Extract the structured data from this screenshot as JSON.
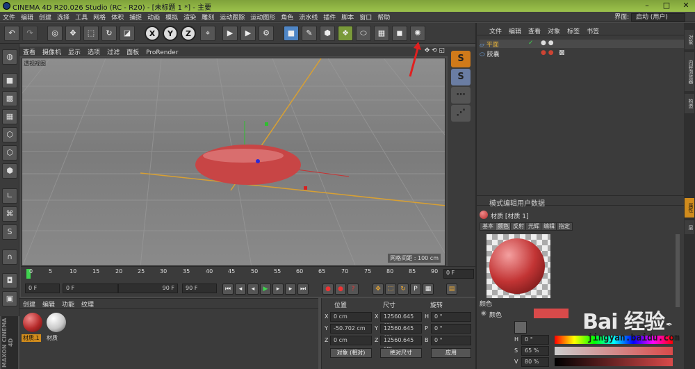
{
  "window": {
    "title": "CINEMA 4D R20.026 Studio (RC - R20) - [未标题 1 *] - 主要",
    "controls": [
      "–",
      "□",
      "✕"
    ]
  },
  "menu": [
    "文件",
    "编辑",
    "创建",
    "选择",
    "工具",
    "网格",
    "体积",
    "捕捉",
    "动画",
    "模拟",
    "渲染",
    "雕刻",
    "运动跟踪",
    "运动图形",
    "角色",
    "流水线",
    "插件",
    "脚本",
    "窗口",
    "帮助"
  ],
  "interface": {
    "label": "界面:",
    "value": "启动 (用户)"
  },
  "viewport": {
    "menu": [
      "查看",
      "摄像机",
      "显示",
      "选项",
      "过滤",
      "面板",
      "ProRender"
    ],
    "label": "透视视图",
    "status": "网格间距 : 100 cm"
  },
  "timeline": {
    "ticks": [
      "0",
      "5",
      "10",
      "15",
      "20",
      "25",
      "30",
      "35",
      "40",
      "45",
      "50",
      "55",
      "60",
      "65",
      "70",
      "75",
      "80",
      "85",
      "90"
    ],
    "current_frame": "0 F"
  },
  "transport": {
    "start": "0 F",
    "range_start": "0 F",
    "range_end": "90 F",
    "end": "90 F"
  },
  "material_manager": {
    "menu": [
      "创建",
      "编辑",
      "功能",
      "纹理"
    ],
    "materials": [
      {
        "name": "材质.1",
        "color": "#b52a2a"
      },
      {
        "name": "材质",
        "color": "#d8d8d8"
      }
    ],
    "brand_text": "MAXON CINEMA 4D"
  },
  "coordinates": {
    "headers": [
      "位置",
      "尺寸",
      "旋转"
    ],
    "rows": [
      {
        "axis": "X",
        "pos": "0 cm",
        "size_axis": "X",
        "size": "12560.645 cm",
        "rot_axis": "H",
        "rot": "0 °"
      },
      {
        "axis": "Y",
        "pos": "-50.702 cm",
        "size_axis": "Y",
        "size": "12560.645 cm",
        "rot_axis": "P",
        "rot": "0 °"
      },
      {
        "axis": "Z",
        "pos": "0 cm",
        "size_axis": "Z",
        "size": "12560.645 cm",
        "rot_axis": "B",
        "rot": "0 °"
      }
    ],
    "mode_object": "对象 (相对)",
    "mode_size": "绝对尺寸",
    "apply": "应用"
  },
  "object_manager": {
    "menu": [
      "文件",
      "编辑",
      "查看",
      "对象",
      "标签",
      "书签"
    ],
    "objects": [
      {
        "name": "平面",
        "selected": true
      },
      {
        "name": "胶囊",
        "selected": false
      }
    ]
  },
  "attribute_manager": {
    "menu": [
      "模式",
      "编辑",
      "用户数据"
    ],
    "title": "材质 [材质 1]",
    "tabs": [
      "基本",
      "颜色",
      "反射",
      "光辉",
      "编辑",
      "指定"
    ],
    "active_tab": "颜色",
    "section": "颜色",
    "color_label": "颜色",
    "swatch_color": "#d94a4a",
    "hsv": [
      {
        "label": "H",
        "value": "0 °"
      },
      {
        "label": "S",
        "value": "65 %"
      },
      {
        "label": "V",
        "value": "80 %"
      }
    ]
  },
  "side_tabs": [
    "对象",
    "内容浏览器",
    "构造",
    "属性",
    "层"
  ],
  "watermark": {
    "brand": "Bai  经验",
    "url": "jingyan.baidu.com"
  }
}
